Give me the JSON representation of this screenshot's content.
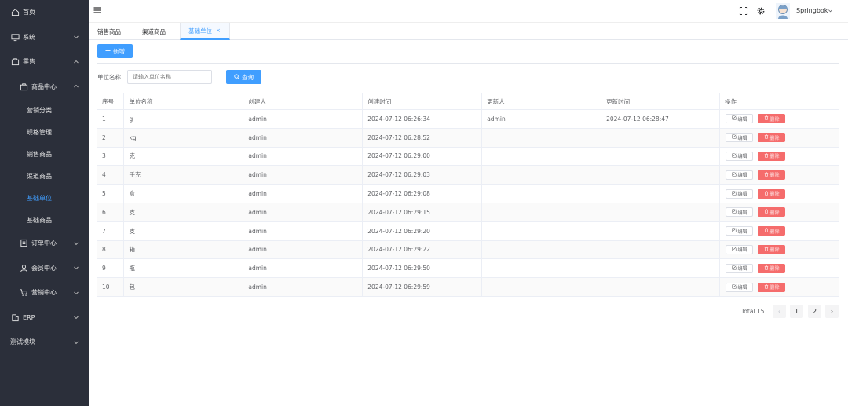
{
  "sidebar": {
    "home": "首页",
    "system": "系统",
    "retail": "零售",
    "goods_center": "商品中心",
    "marketing_category": "营销分类",
    "spec_mgmt": "规格管理",
    "sales_goods": "销售商品",
    "channel_goods": "渠道商品",
    "base_unit": "基础单位",
    "base_goods": "基础商品",
    "order_center": "订单中心",
    "member_center": "会员中心",
    "marketing_center": "营销中心",
    "erp": "ERP",
    "test_module": "测试模块"
  },
  "topbar": {
    "username": "Springbok"
  },
  "tabs": [
    {
      "label": "销售商品"
    },
    {
      "label": "渠道商品"
    },
    {
      "label": "基础单位",
      "close": "×"
    }
  ],
  "toolbar": {
    "add_label": "新增"
  },
  "search": {
    "label": "单位名称",
    "placeholder": "请输入单位名称",
    "query_label": "查询"
  },
  "table": {
    "headers": [
      "序号",
      "单位名称",
      "创建人",
      "创建时间",
      "更新人",
      "更新时间",
      "操作"
    ],
    "edit_label": "编辑",
    "delete_label": "删除",
    "rows": [
      {
        "no": "1",
        "name": "g",
        "creator": "admin",
        "created": "2024-07-12 06:26:34",
        "updater": "admin",
        "updated": "2024-07-12 06:28:47"
      },
      {
        "no": "2",
        "name": "kg",
        "creator": "admin",
        "created": "2024-07-12 06:28:52",
        "updater": "",
        "updated": ""
      },
      {
        "no": "3",
        "name": "克",
        "creator": "admin",
        "created": "2024-07-12 06:29:00",
        "updater": "",
        "updated": ""
      },
      {
        "no": "4",
        "name": "千克",
        "creator": "admin",
        "created": "2024-07-12 06:29:03",
        "updater": "",
        "updated": ""
      },
      {
        "no": "5",
        "name": "盒",
        "creator": "admin",
        "created": "2024-07-12 06:29:08",
        "updater": "",
        "updated": ""
      },
      {
        "no": "6",
        "name": "支",
        "creator": "admin",
        "created": "2024-07-12 06:29:15",
        "updater": "",
        "updated": ""
      },
      {
        "no": "7",
        "name": "支",
        "creator": "admin",
        "created": "2024-07-12 06:29:20",
        "updater": "",
        "updated": ""
      },
      {
        "no": "8",
        "name": "箱",
        "creator": "admin",
        "created": "2024-07-12 06:29:22",
        "updater": "",
        "updated": ""
      },
      {
        "no": "9",
        "name": "瓶",
        "creator": "admin",
        "created": "2024-07-12 06:29:50",
        "updater": "",
        "updated": ""
      },
      {
        "no": "10",
        "name": "包",
        "creator": "admin",
        "created": "2024-07-12 06:29:59",
        "updater": "",
        "updated": ""
      }
    ]
  },
  "pagination": {
    "total": "Total 15",
    "pages": [
      "1",
      "2"
    ],
    "prev": "‹",
    "next": "›"
  },
  "colors": {
    "accent": "#409eff",
    "danger": "#f56c6c",
    "sidebar_bg": "#2b2f3a"
  }
}
